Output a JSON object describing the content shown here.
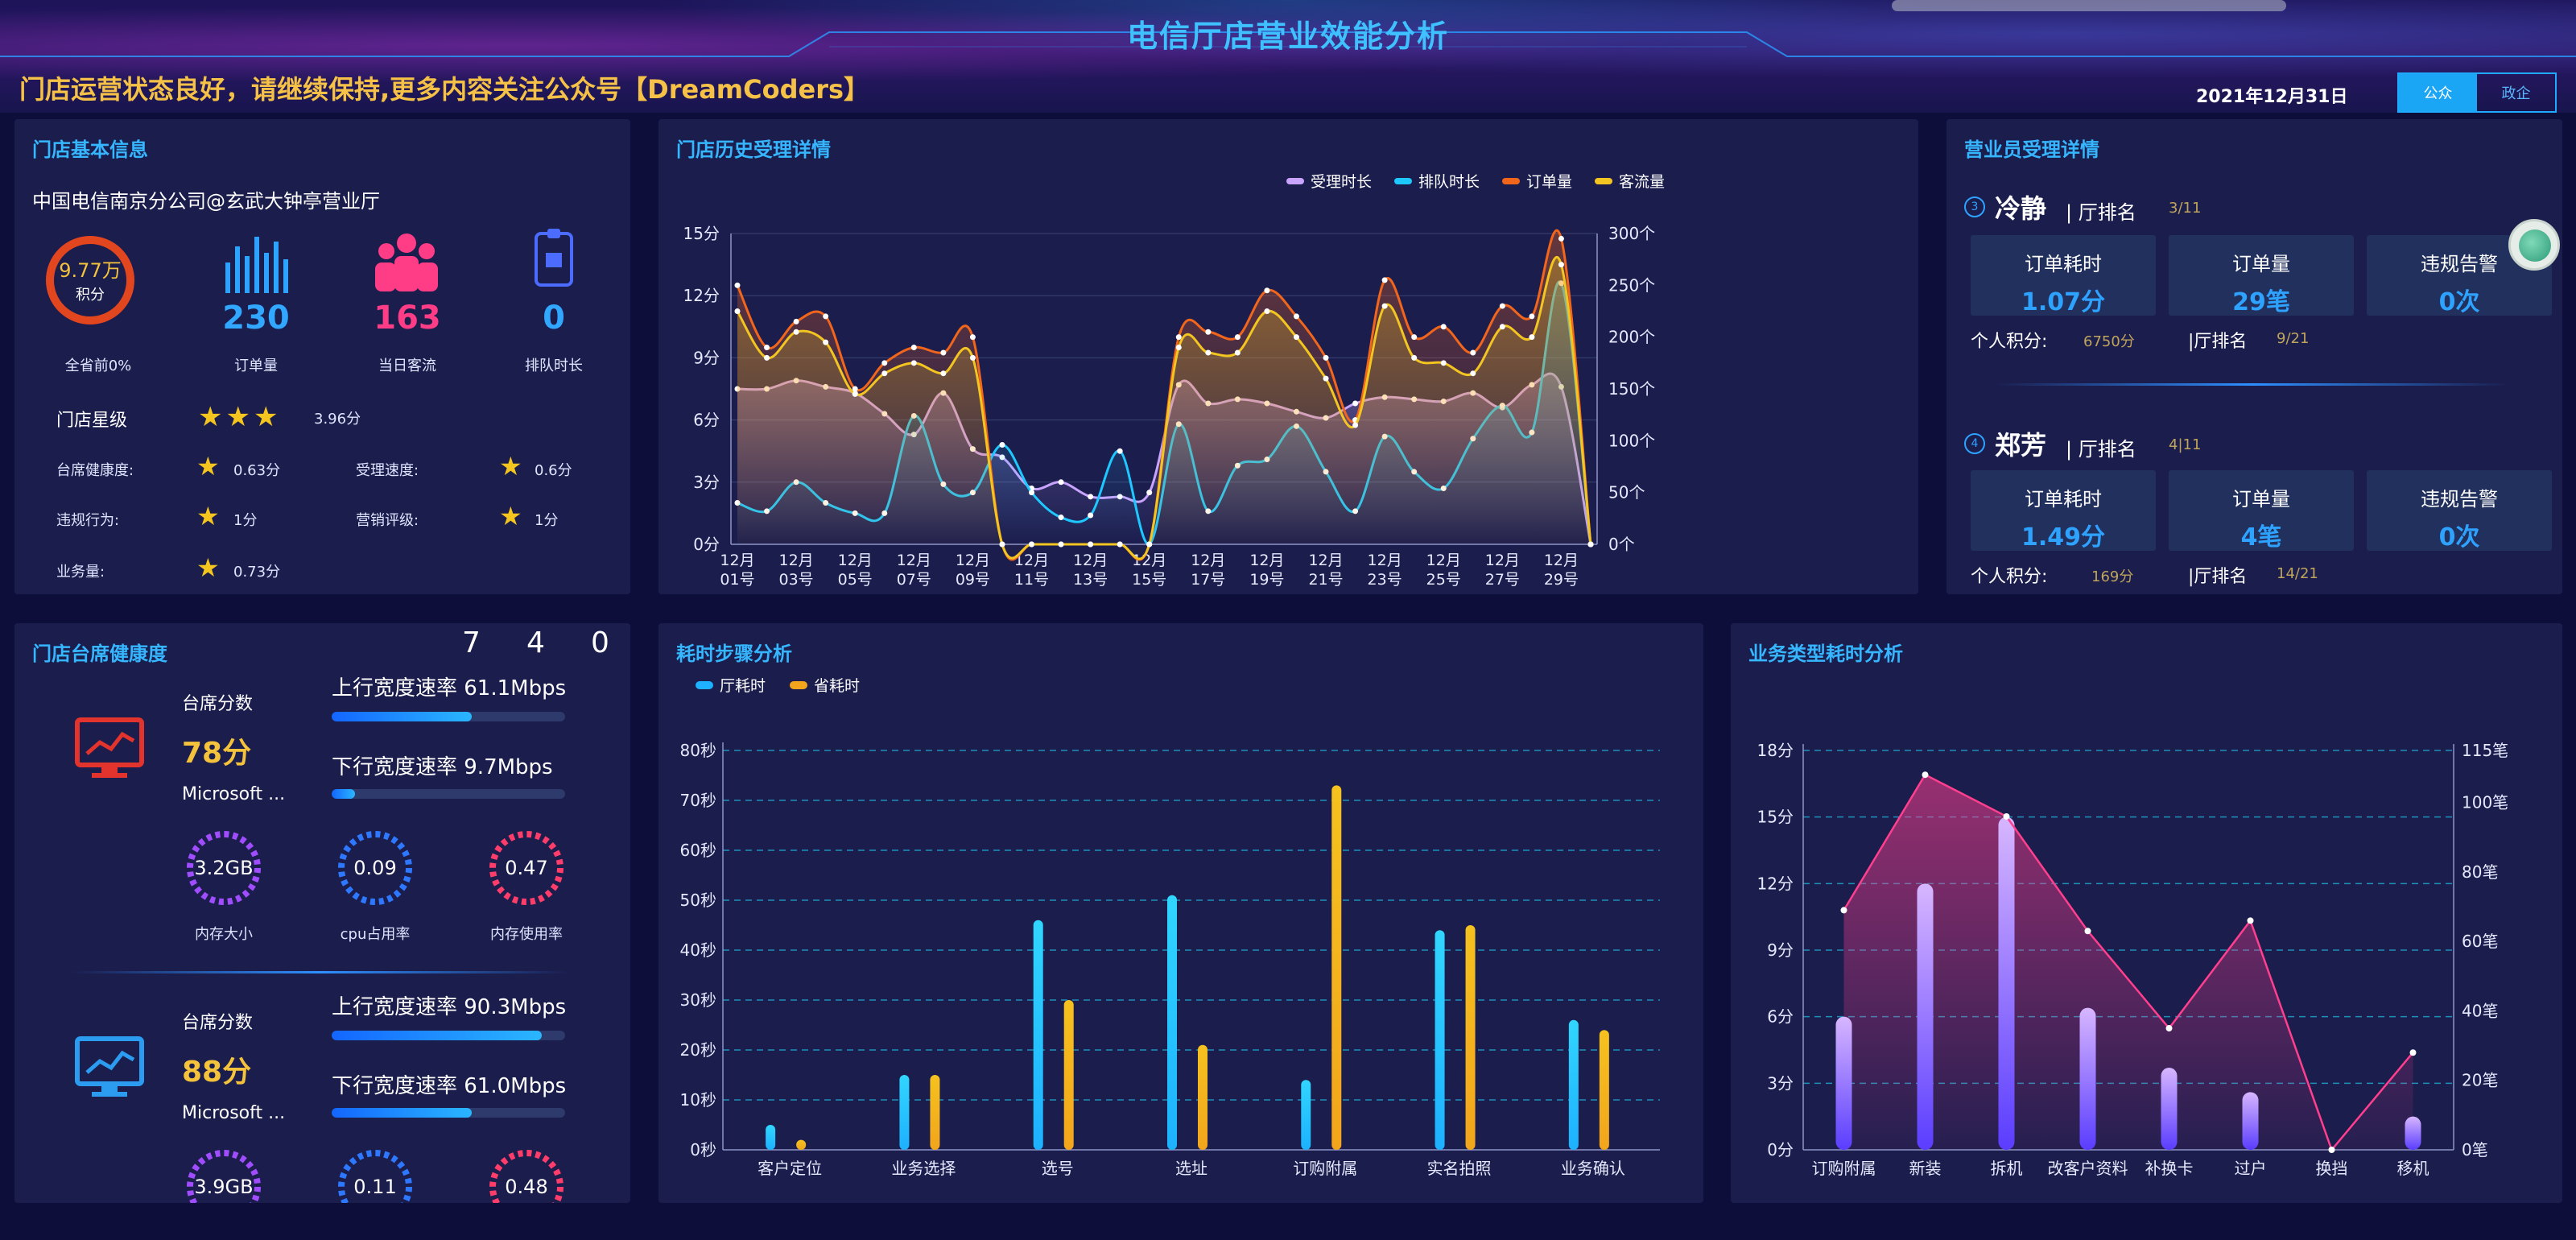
{
  "header": {
    "title": "电信厅店营业效能分析",
    "marquee": "门店运营状态良好，请继续保持,更多内容关注公众号【DreamCoders】",
    "date": "2021年12月31日",
    "toggle": [
      "公众",
      "政企"
    ]
  },
  "store_info": {
    "title": "门店基本信息",
    "name": "中国电信南京分公司@玄武大钟亭营业厅",
    "score_value": "9.77万",
    "score_unit": "积分",
    "score_caption": "全省前0%",
    "orders_value": "230",
    "orders_caption": "订单量",
    "visitors_value": "163",
    "visitors_caption": "当日客流",
    "queue_value": "0",
    "queue_caption": "排队时长",
    "star_label": "门店星级",
    "star_score": "3.96分",
    "stars": 3,
    "ratings": [
      {
        "label": "台席健康度:",
        "value": "0.63分"
      },
      {
        "label": "受理速度:",
        "value": "0.6分"
      },
      {
        "label": "违规行为:",
        "value": "1分"
      },
      {
        "label": "营销评级:",
        "value": "1分"
      },
      {
        "label": "业务量:",
        "value": "0.73分"
      }
    ]
  },
  "history": {
    "title": "门店历史受理详情",
    "chart_data": {
      "type": "line",
      "x": [
        "12月01号",
        "12月02号",
        "12月03号",
        "12月04号",
        "12月05号",
        "12月06号",
        "12月07号",
        "12月08号",
        "12月09号",
        "12月10号",
        "12月11号",
        "12月12号",
        "12月13号",
        "12月14号",
        "12月15号",
        "12月16号",
        "12月17号",
        "12月18号",
        "12月19号",
        "12月20号",
        "12月21号",
        "12月22号",
        "12月23号",
        "12月24号",
        "12月25号",
        "12月26号",
        "12月27号",
        "12月28号",
        "12月29号",
        "12月30号"
      ],
      "x_tick_labels": [
        "12月01号",
        "12月03号",
        "12月05号",
        "12月07号",
        "12月09号",
        "12月11号",
        "12月13号",
        "12月15号",
        "12月17号",
        "12月19号",
        "12月21号",
        "12月23号",
        "12月25号",
        "12月27号",
        "12月29号"
      ],
      "left_axis": {
        "ticks": [
          "0分",
          "3分",
          "6分",
          "9分",
          "12分",
          "15分"
        ],
        "ylim": [
          0,
          15
        ]
      },
      "right_axis": {
        "ticks": [
          "0个",
          "50个",
          "100个",
          "150个",
          "200个",
          "250个",
          "300个"
        ],
        "ylim": [
          0,
          300
        ]
      },
      "series": [
        {
          "name": "受理时长",
          "color": "#c9a4ff",
          "axis": "left",
          "values": [
            7.5,
            7.5,
            7.9,
            7.6,
            7.3,
            6.3,
            5.3,
            7.3,
            4.6,
            4.2,
            2.7,
            3.0,
            2.3,
            2.3,
            2.5,
            7.7,
            6.8,
            7.0,
            6.8,
            6.4,
            6.1,
            6.8,
            7.1,
            7.0,
            6.9,
            7.3,
            6.6,
            7.7,
            7.6,
            0
          ]
        },
        {
          "name": "排队时长",
          "color": "#1ec8ff",
          "axis": "left",
          "values": [
            2.0,
            1.6,
            3.0,
            2.0,
            1.5,
            1.5,
            6.2,
            2.9,
            2.5,
            4.8,
            2.5,
            1.3,
            1.4,
            4.5,
            0.0,
            5.8,
            1.6,
            3.8,
            4.1,
            5.7,
            3.5,
            1.6,
            5.2,
            3.5,
            2.7,
            5.1,
            6.7,
            5.4,
            12.6,
            0
          ]
        },
        {
          "name": "订单量",
          "color": "#f2661c",
          "axis": "right",
          "values": [
            250,
            190,
            215,
            220,
            150,
            175,
            190,
            185,
            200,
            0,
            0,
            0,
            0,
            0,
            0,
            200,
            205,
            200,
            245,
            220,
            180,
            120,
            255,
            200,
            210,
            185,
            230,
            220,
            295,
            0
          ]
        },
        {
          "name": "客流量",
          "color": "#f3c520",
          "axis": "right",
          "values": [
            225,
            180,
            205,
            195,
            145,
            165,
            175,
            165,
            180,
            0,
            0,
            0,
            0,
            0,
            0,
            190,
            185,
            185,
            225,
            200,
            160,
            115,
            230,
            180,
            175,
            165,
            210,
            200,
            270,
            0
          ]
        }
      ]
    }
  },
  "clerks": {
    "title": "营业员受理详情",
    "items": [
      {
        "rank_icon": "3",
        "name": "冷静",
        "hall_rank_label": "| 厅排名",
        "hall_rank": "3/11",
        "kpis": [
          {
            "label": "订单耗时",
            "value": "1.07分"
          },
          {
            "label": "订单量",
            "value": "29笔"
          },
          {
            "label": "违规告警",
            "value": "0次"
          }
        ],
        "points_label": "个人积分:",
        "points": "6750分",
        "rank2_label": "|厅排名",
        "rank2": "9/21"
      },
      {
        "rank_icon": "4",
        "name": "郑芳",
        "hall_rank_label": "| 厅排名",
        "hall_rank": "4|11",
        "kpis": [
          {
            "label": "订单耗时",
            "value": "1.49分"
          },
          {
            "label": "订单量",
            "value": "4笔"
          },
          {
            "label": "违规告警",
            "value": "0次"
          }
        ],
        "points_label": "个人积分:",
        "points": "169分",
        "rank2_label": "|厅排名",
        "rank2": "14/21"
      }
    ]
  },
  "health": {
    "title": "门店台席健康度",
    "digits": [
      "7",
      "4",
      "0"
    ],
    "desks": [
      {
        "score_label": "台席分数",
        "score": "78分",
        "os": "Microsoft ...",
        "up": "上行宽度速率 61.1Mbps",
        "up_fraction": 0.6,
        "down": "下行宽度速率 9.7Mbps",
        "down_fraction": 0.1,
        "gauges": [
          {
            "value": "3.2GB",
            "caption": "内存大小",
            "color": "#a04cff"
          },
          {
            "value": "0.09",
            "caption": "cpu占用率",
            "color": "#2e78ff"
          },
          {
            "value": "0.47",
            "caption": "内存使用率",
            "color": "#ff3d6b"
          }
        ],
        "icon_color": "#e2332c"
      },
      {
        "score_label": "台席分数",
        "score": "88分",
        "os": "Microsoft ...",
        "up": "上行宽度速率 90.3Mbps",
        "up_fraction": 0.9,
        "down": "下行宽度速率 61.0Mbps",
        "down_fraction": 0.6,
        "gauges": [
          {
            "value": "3.9GB",
            "caption": "内存大小",
            "color": "#a04cff"
          },
          {
            "value": "0.11",
            "caption": "cpu占用率",
            "color": "#2e78ff"
          },
          {
            "value": "0.48",
            "caption": "内存使用率",
            "color": "#ff3d6b"
          }
        ],
        "icon_color": "#2b9cf0"
      }
    ]
  },
  "steps": {
    "title": "耗时步骤分析",
    "chart_data": {
      "type": "bar",
      "categories": [
        "客户定位",
        "业务选择",
        "选号",
        "选址",
        "订购附属",
        "实名拍照",
        "业务确认"
      ],
      "ylim": [
        0,
        80
      ],
      "y_ticks": [
        "0秒",
        "10秒",
        "20秒",
        "30秒",
        "40秒",
        "50秒",
        "60秒",
        "70秒",
        "80秒"
      ],
      "series": [
        {
          "name": "厅耗时",
          "color": "#1db1ff",
          "values": [
            5,
            15,
            46,
            51,
            14,
            44,
            26
          ]
        },
        {
          "name": "省耗时",
          "color": "#f2a51c",
          "values": [
            2,
            15,
            30,
            21,
            73,
            45,
            24
          ]
        }
      ]
    }
  },
  "biztype": {
    "title": "业务类型耗时分析",
    "chart_data": {
      "type": "bar",
      "categories": [
        "订购附属",
        "新装",
        "拆机",
        "改客户资料",
        "补换卡",
        "过户",
        "换挡",
        "移机"
      ],
      "left_axis": {
        "ticks": [
          "0分",
          "3分",
          "6分",
          "9分",
          "12分",
          "15分",
          "18分"
        ],
        "ylim": [
          0,
          18
        ]
      },
      "right_axis": {
        "ticks": [
          "0笔",
          "20笔",
          "40笔",
          "60笔",
          "80笔",
          "100笔",
          "115笔"
        ],
        "ylim": [
          0,
          115
        ]
      },
      "series": [
        {
          "name": "耗时",
          "axis": "left",
          "color": "#9a7cff",
          "values": [
            6,
            12,
            15,
            6.4,
            3.7,
            2.6,
            0,
            1.5
          ]
        },
        {
          "name": "笔数",
          "axis": "right",
          "color": "#ff3f8e",
          "values": [
            69,
            108,
            96,
            63,
            35,
            66,
            0,
            28
          ]
        }
      ]
    }
  }
}
